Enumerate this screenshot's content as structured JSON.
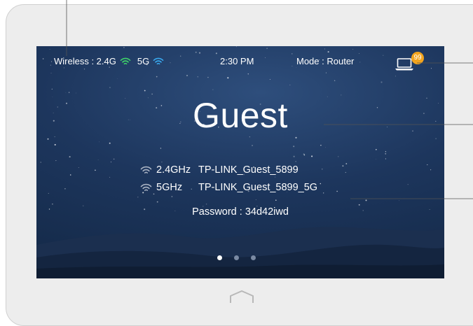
{
  "status_bar": {
    "wireless_label": "Wireless : 2.4G",
    "band_5g_label": "5G",
    "time": "2:30 PM",
    "mode": "Mode : Router",
    "clients_count": "99"
  },
  "main": {
    "title": "Guest",
    "networks": [
      {
        "band": "2.4GHz",
        "ssid": "TP-LINK_Guest_5899"
      },
      {
        "band": "5GHz",
        "ssid": "TP-LINK_Guest_5899_5G"
      }
    ],
    "password": "Password : 34d42iwd"
  },
  "pager": {
    "pages": 3,
    "active": 0
  },
  "icons": {
    "wifi_2g": "wifi-icon",
    "wifi_5g": "wifi-icon",
    "clients": "laptop-icon",
    "home": "home-icon"
  },
  "colors": {
    "wifi_2g": "#3fd46a",
    "wifi_5g": "#39a9f0",
    "badge": "#f2a41e",
    "screen_bg": "#1d365d"
  }
}
